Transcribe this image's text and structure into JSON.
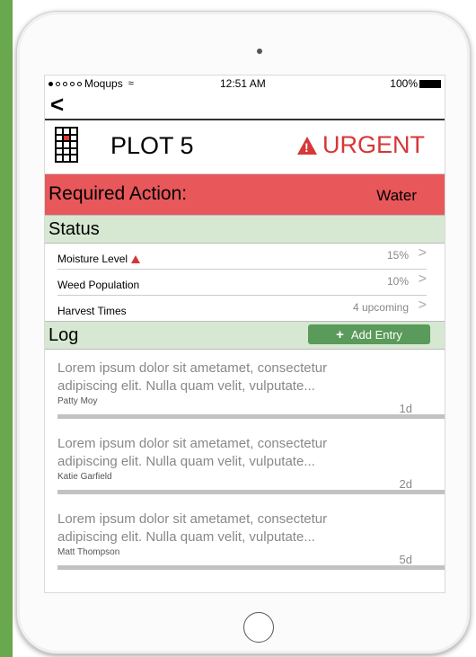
{
  "statusbar": {
    "carrier": "Moqups",
    "time": "12:51 AM",
    "battery": "100%"
  },
  "nav": {
    "back_label": "<"
  },
  "header": {
    "plot_title": "PLOT 5",
    "urgent_label": "URGENT",
    "urgent_color": "#d63737"
  },
  "required": {
    "label": "Required Action:",
    "value": "Water",
    "background": "#e8575a"
  },
  "status": {
    "title": "Status",
    "rows": [
      {
        "label": "Moisture Level",
        "value": "15%",
        "chevron": ">"
      },
      {
        "label": "Weed Population",
        "value": "10%",
        "chevron": ">"
      },
      {
        "label": "Harvest Times",
        "value": "4 upcoming",
        "chevron": ">"
      }
    ]
  },
  "log": {
    "title": "Log",
    "add_label": "Add Entry",
    "entries": [
      {
        "text": "Lorem ipsum dolor sit ametamet, consectetur adipiscing elit. Nulla quam velit, vulputate...",
        "author": "Patty Moy",
        "age": "1d"
      },
      {
        "text": "Lorem ipsum dolor sit ametamet, consectetur adipiscing elit. Nulla quam velit, vulputate...",
        "author": "Katie Garfield",
        "age": "2d"
      },
      {
        "text": "Lorem ipsum dolor sit ametamet, consectetur adipiscing elit. Nulla quam velit, vulputate...",
        "author": "Matt Thompson",
        "age": "5d"
      }
    ]
  },
  "colors": {
    "section_green": "#d6e8d2",
    "button_green": "#5a9a5a",
    "side_green": "#6aa84f"
  },
  "icons": {
    "back": "chevron-left-icon",
    "plot": "plot-grid-icon",
    "urgent": "warning-triangle-icon",
    "add": "plus-icon",
    "row": "chevron-right-icon"
  }
}
